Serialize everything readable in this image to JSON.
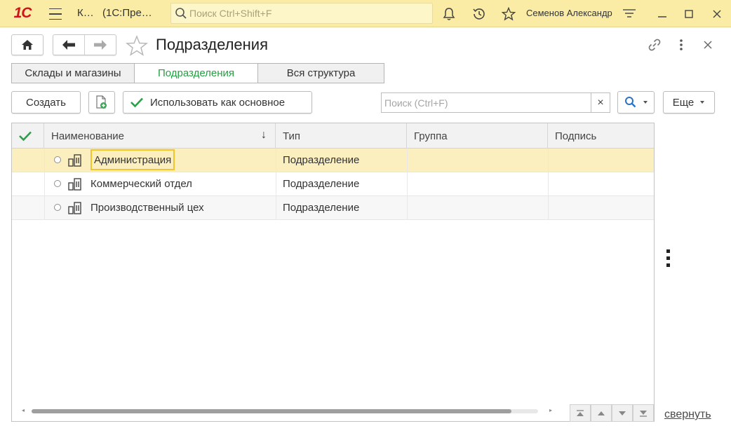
{
  "titlebar": {
    "logo": "1С",
    "app_short": "К…",
    "app_title": "(1С:Пре…",
    "search_placeholder": "Поиск Ctrl+Shift+F",
    "user": "Семенов Александр",
    "icons": [
      "bell-icon",
      "history-icon",
      "star-icon",
      "settings-lines-icon",
      "minimize-icon",
      "maximize-icon",
      "close-icon"
    ]
  },
  "header": {
    "title": "Подразделения"
  },
  "tabs": [
    {
      "label": "Склады и магазины",
      "active": false
    },
    {
      "label": "Подразделения",
      "active": true
    },
    {
      "label": "Вся структура",
      "active": false
    }
  ],
  "toolbar": {
    "create_label": "Создать",
    "use_main_label": "Использовать как основное",
    "search_placeholder": "Поиск (Ctrl+F)",
    "search_clear": "×",
    "more_label": "Еще"
  },
  "table": {
    "columns": [
      "Наименование",
      "Тип",
      "Группа",
      "Подпись"
    ],
    "sort_indicator": "↓",
    "rows": [
      {
        "name": "Администрация",
        "type": "Подразделение",
        "group": "",
        "signature": "",
        "selected": true
      },
      {
        "name": "Коммерческий отдел",
        "type": "Подразделение",
        "group": "",
        "signature": "",
        "selected": false
      },
      {
        "name": "Производственный цех",
        "type": "Подразделение",
        "group": "",
        "signature": "",
        "selected": false
      }
    ]
  },
  "footer": {
    "collapse_label": "свернуть"
  },
  "colors": {
    "titlebar_bg": "#fbeca5",
    "accent_green": "#279d44",
    "selection": "#fbefc0",
    "focus_border": "#f2c52c",
    "logo_red": "#d1121b",
    "search_blue": "#2a72c6"
  }
}
